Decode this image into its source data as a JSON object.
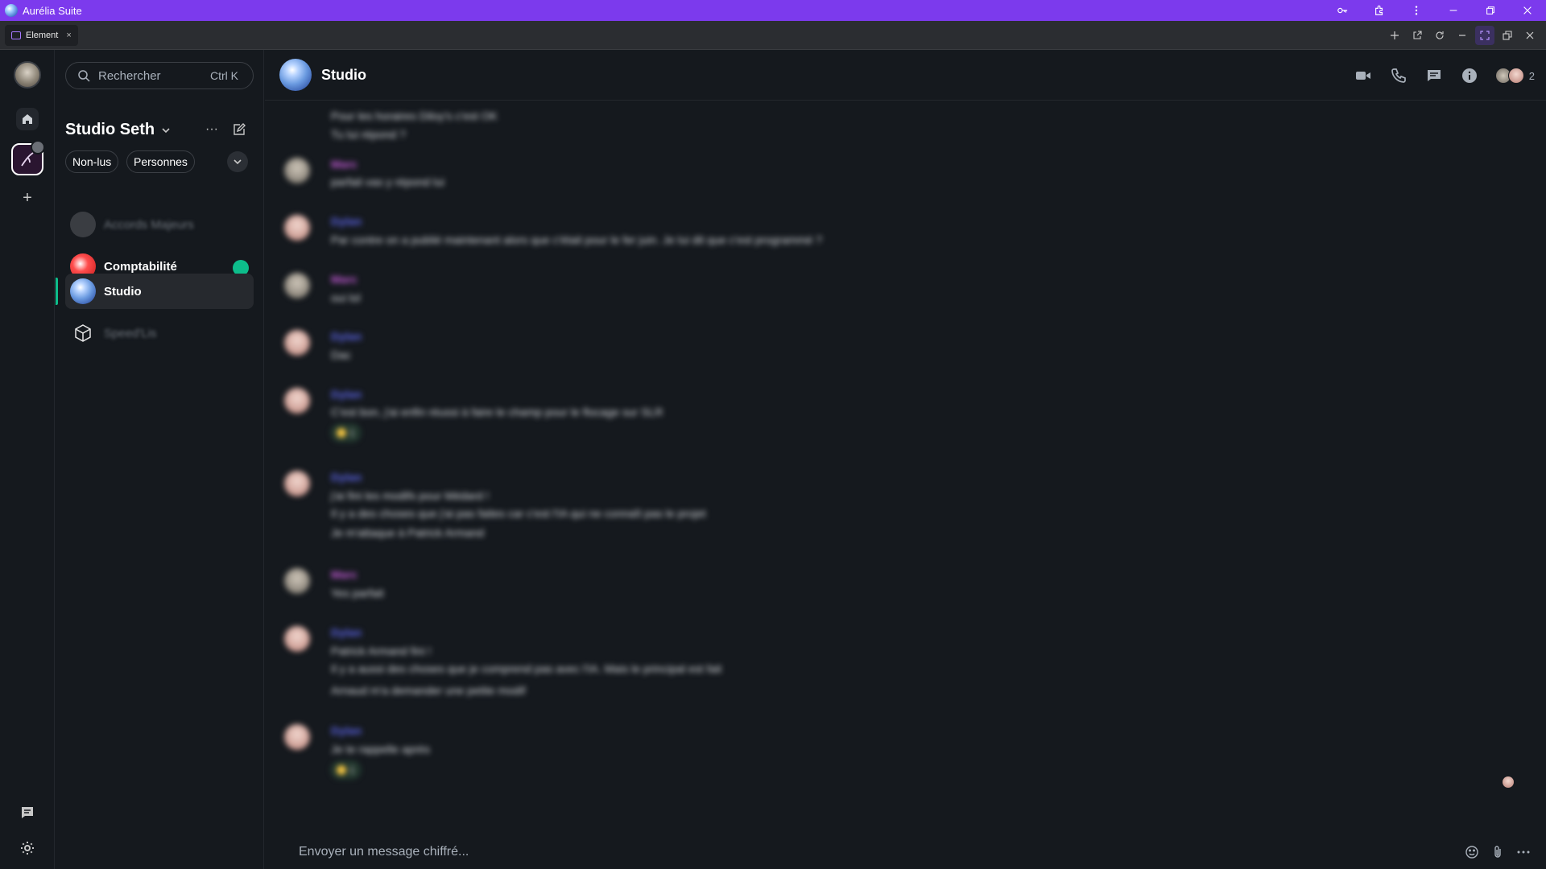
{
  "window": {
    "app_title": "Aurélia Suite",
    "tab_label": "Element",
    "tab_close": "×",
    "accent": "#7c3aed"
  },
  "sidebar": {
    "add_label": "+"
  },
  "roomlist": {
    "search_placeholder": "Rechercher",
    "search_shortcut": "Ctrl K",
    "space_name": "Studio Seth",
    "more_label": "···",
    "filters": [
      "Non-lus",
      "Personnes"
    ],
    "rooms": [
      {
        "name": "Accords Majeurs",
        "state": "dim"
      },
      {
        "name": "Comptabilité",
        "state": "unread"
      },
      {
        "name": "Studio",
        "state": "active"
      },
      {
        "name": "Speed'Lis",
        "state": "dim"
      }
    ],
    "unread_color": "#0dbd8b"
  },
  "room": {
    "name": "Studio",
    "member_count": "2"
  },
  "timeline": {
    "groups": [
      {
        "sender": "",
        "lines": [
          "Pour les horaires Diloy's c'est OK",
          "Tu lui répond ?"
        ]
      },
      {
        "sender": "Marc",
        "lines": [
          "parfait vas y répond lui"
        ]
      },
      {
        "sender": "Dylan",
        "lines": [
          "Par contre on a publié maintenant alors que c'était pour le fer juin. Je lui dit que c'est programmé ?"
        ]
      },
      {
        "sender": "Marc",
        "lines": [
          "oui lol"
        ]
      },
      {
        "sender": "Dylan",
        "lines": [
          "Dac"
        ]
      },
      {
        "sender": "Dylan",
        "lines": [
          "C'est bon, j'ai enfin réussi à faire le champ pour le flocage sur SLR"
        ],
        "reaction": "1"
      },
      {
        "sender": "Dylan",
        "lines": [
          "j'ai fini les modifs pour Médard !",
          "Il y a des choses que j'ai pas faites car c'est l'IA qui ne connaît pas le projet",
          "Je m'attaque à Patrick Armand"
        ]
      },
      {
        "sender": "Marc",
        "lines": [
          "Yes parfait"
        ]
      },
      {
        "sender": "Dylan",
        "lines": [
          "Patrick Armand fini !",
          "Il y a aussi des choses que je comprend pas avec l'IA. Mais le principal est fait",
          "Arnaud m'a demander une petite modif"
        ]
      },
      {
        "sender": "Dylan",
        "lines": [
          "Je te rappelle après"
        ],
        "reaction": "1"
      }
    ]
  },
  "composer": {
    "placeholder": "Envoyer un message chiffré..."
  }
}
